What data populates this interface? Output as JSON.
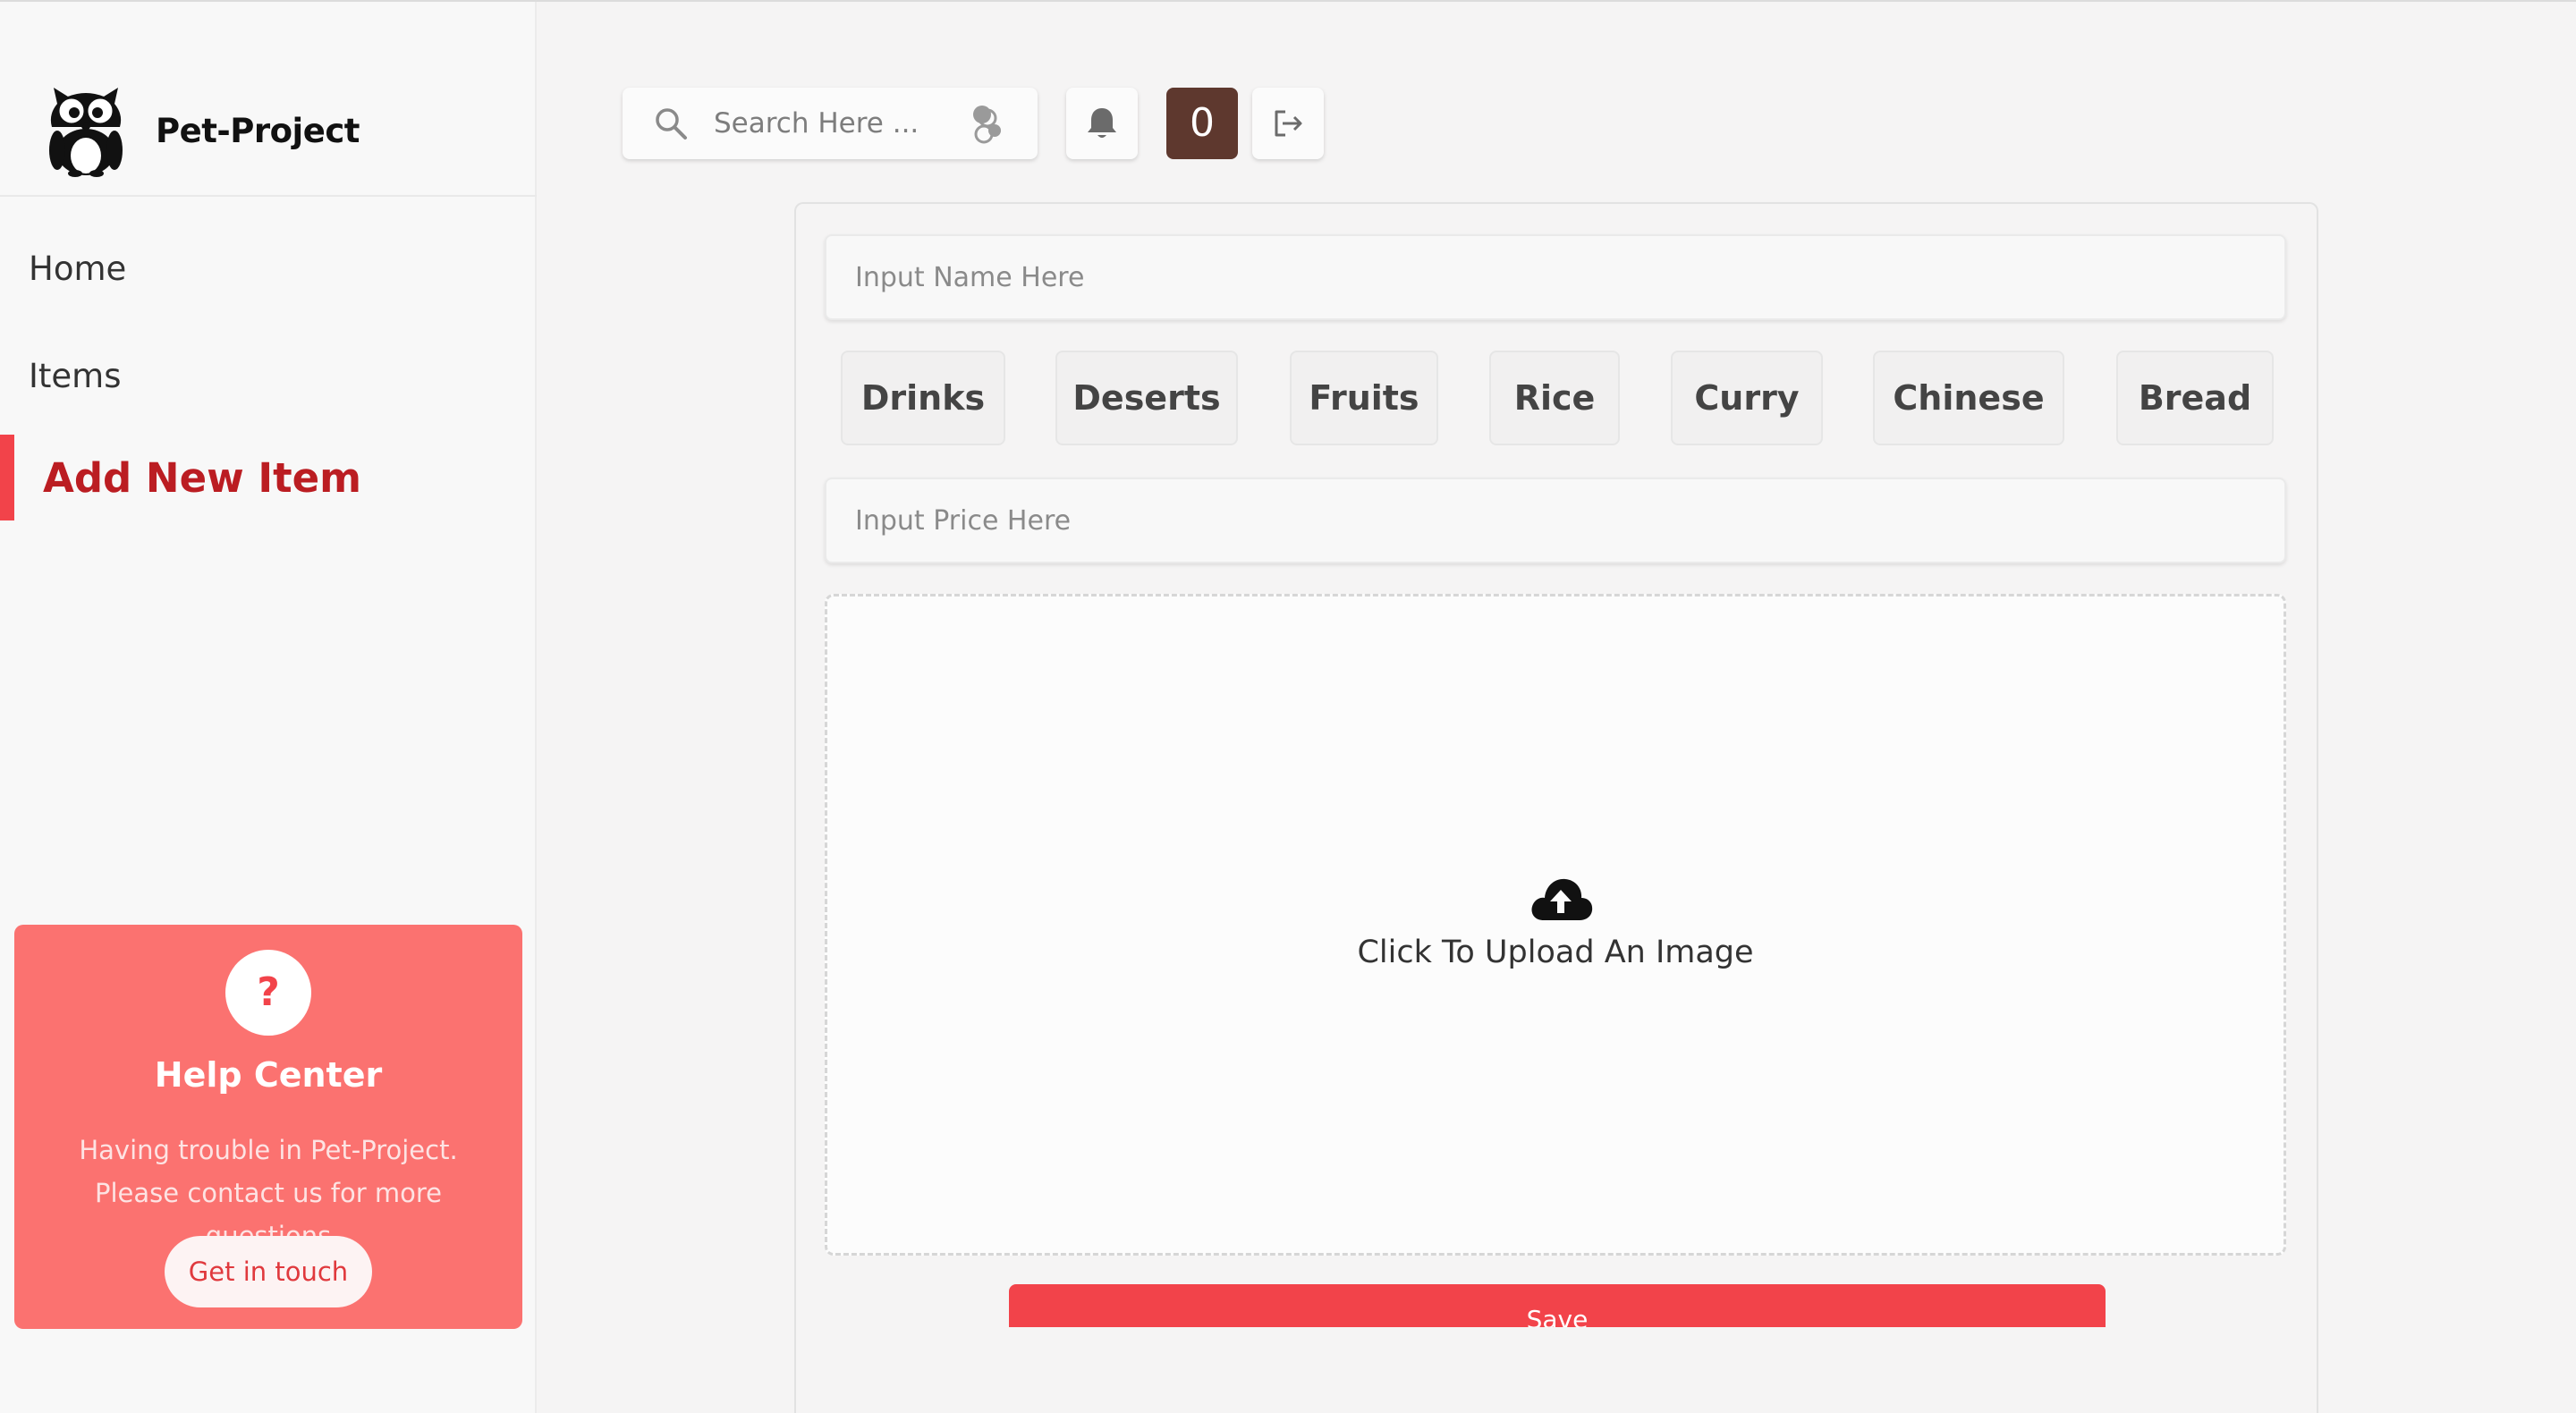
{
  "app": {
    "name": "Pet-Project"
  },
  "sidebar": {
    "items": [
      {
        "label": "Home",
        "active": false
      },
      {
        "label": "Items",
        "active": false
      },
      {
        "label": "Add New Item",
        "active": true
      }
    ],
    "help": {
      "icon": "question-mark-icon",
      "icon_text": "?",
      "title": "Help Center",
      "text": "Having trouble in Pet-Project. Please contact us for more questions",
      "button": "Get in touch"
    }
  },
  "topbar": {
    "search_placeholder": "Search Here ...",
    "count": "0",
    "icons": [
      "search-icon",
      "filter-icon",
      "bell-icon",
      "logout-icon"
    ]
  },
  "form": {
    "name_placeholder": "Input Name Here",
    "categories": [
      "Drinks",
      "Deserts",
      "Fruits",
      "Rice",
      "Curry",
      "Chinese",
      "Bread"
    ],
    "price_placeholder": "Input Price Here",
    "upload_label": "Click To Upload An Image",
    "save_label": "Save"
  },
  "colors": {
    "accent": "#f2434a",
    "active_nav": "#bb1d22",
    "help_bg": "#fb7270",
    "count_bg": "#5e382e",
    "background": "#f5f4f4"
  }
}
